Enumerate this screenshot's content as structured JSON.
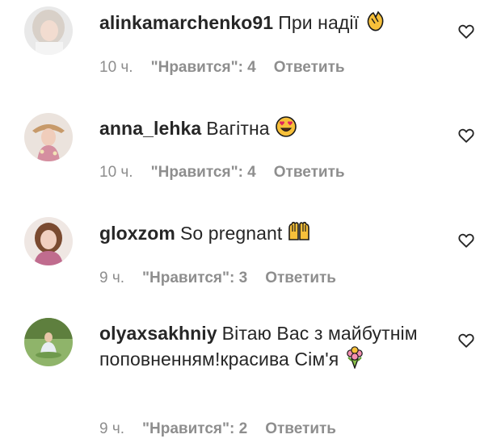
{
  "comments": [
    {
      "username": "alinkamarchenko91",
      "text": "При надії",
      "emoji": "clapping-hands-icon",
      "time": "10 ч.",
      "likes": "\"Нравится\": 4",
      "reply": "Ответить"
    },
    {
      "username": "anna_lehka",
      "text": "Вагітна",
      "emoji": "heart-eyes-face-icon",
      "time": "10 ч.",
      "likes": "\"Нравится\": 4",
      "reply": "Ответить"
    },
    {
      "username": "gloxzom",
      "text": "So pregnant",
      "emoji": "raising-hands-icon",
      "time": "9 ч.",
      "likes": "\"Нравится\": 3",
      "reply": "Ответить"
    },
    {
      "username": "olyaxsakhniy",
      "text": "Вітаю Вас з майбутнім поповненням!красива Сім'я",
      "emoji": "bouquet-icon",
      "time": "9 ч.",
      "likes": "\"Нравится\": 2",
      "reply": "Ответить"
    }
  ],
  "colors": {
    "text": "#262626",
    "meta": "#8e8e8e",
    "emoji_yellow": "#f7c03a",
    "heart_outline": "#262626"
  }
}
